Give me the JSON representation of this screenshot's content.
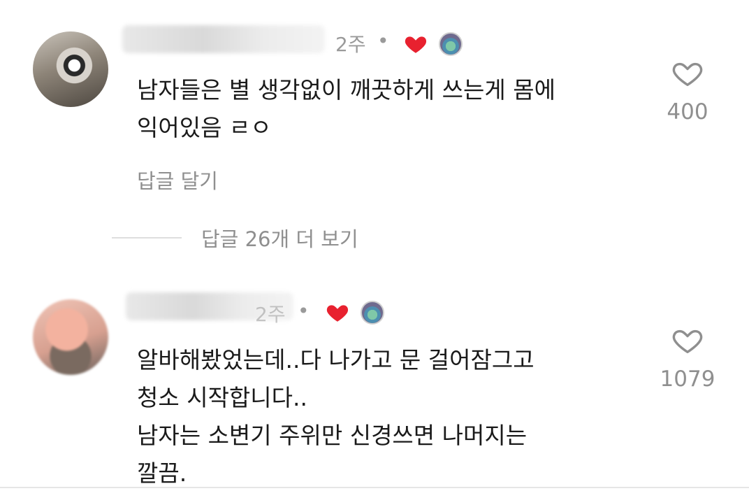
{
  "comments": [
    {
      "time_ago": "2주",
      "text_lines": [
        "남자들은 별 생각없이 깨끗하게 쓰는게 몸에",
        "익어있음 ㄹㅇ"
      ],
      "reply_label": "답글 달기",
      "like_count": "400",
      "creator_liked": true
    },
    {
      "time_ago": "2주",
      "text_lines": [
        "알바해봤었는데..다 나가고 문 걸어잠그고",
        "청소 시작합니다..",
        "남자는 소변기 주위만 신경쓰면 나머지는",
        "깔끔."
      ],
      "like_count": "1079",
      "creator_liked": true
    }
  ],
  "view_replies_label": "답글 26개 더 보기",
  "colors": {
    "liked_heart": "#e8212f",
    "meta_text": "#9a9a9a",
    "body_text": "#1a1a1a"
  },
  "icons": {
    "like": "heart-outline-icon",
    "creator_like": "heart-filled-icon"
  }
}
